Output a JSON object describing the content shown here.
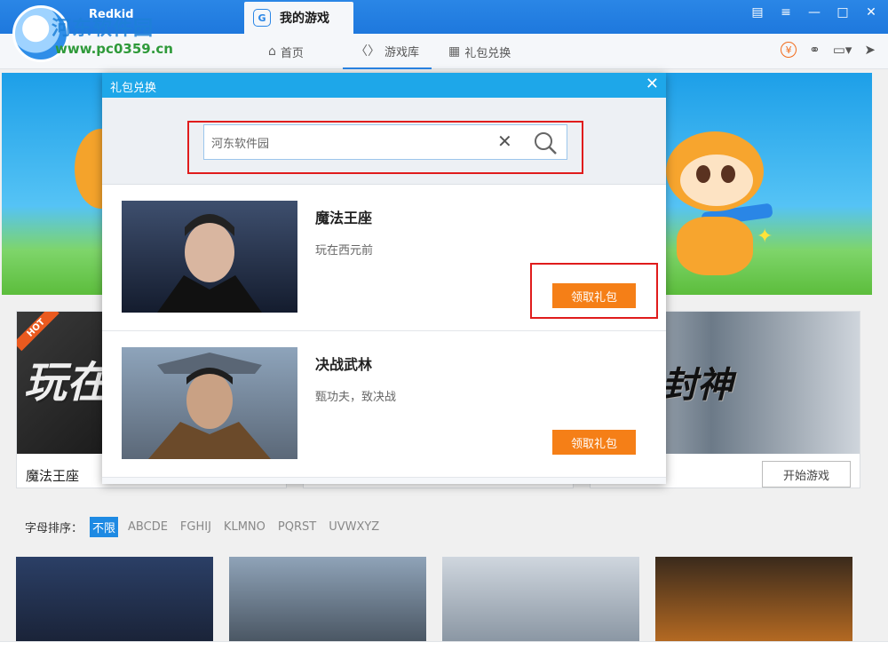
{
  "app": {
    "brand": "Redkid",
    "watermark_title": "河东软件园",
    "watermark_url": "www.pc0359.cn"
  },
  "titlebar": {
    "tab_label": "我的游戏",
    "tab_icon": "G",
    "controls": [
      "message-icon",
      "menu-icon",
      "minimize-icon",
      "maximize-icon",
      "close-icon"
    ]
  },
  "nav": {
    "items": [
      {
        "label": "首页",
        "icon": "home-icon"
      },
      {
        "label": "游戏库",
        "icon": "gamepad-icon"
      },
      {
        "label": "礼包兑换",
        "icon": "gift-icon"
      }
    ],
    "active_index": 1,
    "right_icons": [
      "coin-icon",
      "headset-icon",
      "monitor-icon",
      "rocket-icon"
    ]
  },
  "cards": [
    {
      "title": "魔法王座",
      "badge": "HOT",
      "art_text": "玩在西元"
    },
    {
      "title": "",
      "button": ""
    },
    {
      "title": "",
      "button": ""
    },
    {
      "title": "",
      "button": "开始游戏",
      "art_text": "封神"
    }
  ],
  "sort": {
    "label": "字母排序：",
    "items": [
      "不限",
      "ABCDE",
      "FGHIJ",
      "KLMNO",
      "PQRST",
      "UVWXYZ"
    ],
    "active_index": 0
  },
  "dialog": {
    "title": "礼包兑换",
    "search": {
      "value": "河东软件园"
    },
    "gifts": [
      {
        "name": "魔法王座",
        "desc": "玩在西元前",
        "button": "领取礼包"
      },
      {
        "name": "决战武林",
        "desc": "甄功夫，致决战",
        "button": "领取礼包"
      }
    ]
  },
  "colors": {
    "titlebar": "#1e78dd",
    "accent": "#2a86e6",
    "dialog_header": "#1ea7e9",
    "button_orange": "#f57f17",
    "highlight_red": "#e01c1c"
  }
}
